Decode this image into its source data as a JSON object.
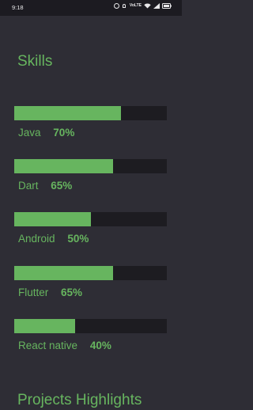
{
  "status_bar": {
    "time": "9:18",
    "icons": [
      "alarm-icon",
      "mute-icon",
      "data-icon",
      "wifi-icon",
      "signal-icon",
      "battery-icon"
    ],
    "data_text": "VoLTE"
  },
  "skills_section": {
    "title": "Skills",
    "accent_color": "#67b55f",
    "track_color": "#1d1c21",
    "items": [
      {
        "name": "Java",
        "percent_label": "70%",
        "percent": 70
      },
      {
        "name": "Dart",
        "percent_label": "65%",
        "percent": 65
      },
      {
        "name": "Android",
        "percent_label": "50%",
        "percent": 50
      },
      {
        "name": "Flutter",
        "percent_label": "65%",
        "percent": 65
      },
      {
        "name": "React native",
        "percent_label": "40%",
        "percent": 40
      }
    ]
  },
  "projects_section": {
    "title": "Projects Highlights"
  }
}
